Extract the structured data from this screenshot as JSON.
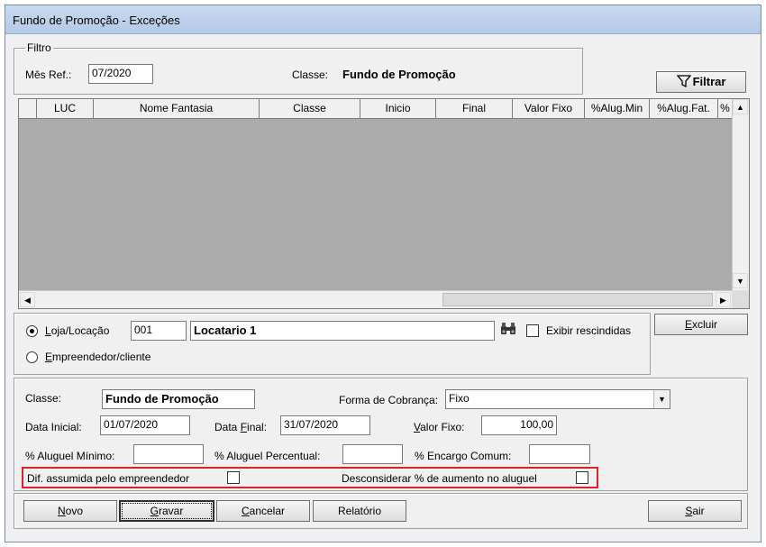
{
  "window": {
    "title": "Fundo de Promoção - Exceções"
  },
  "filtro": {
    "legend": "Filtro",
    "mes_ref_label": "Mês Ref.:",
    "mes_ref_value": "07/2020",
    "classe_label": "Classe:",
    "classe_value": "Fundo de Promoção",
    "filtrar_button": "Filtrar"
  },
  "grid": {
    "columns": [
      "",
      "LUC",
      "Nome Fantasia",
      "Classe",
      "Inicio",
      "Final",
      "Valor Fixo",
      "%Alug.Min",
      "%Alug.Fat.",
      "%"
    ],
    "rows": []
  },
  "selection": {
    "loja_label_u": "L",
    "loja_label_rest": "oja/Locação",
    "loja_code": "001",
    "loja_name": "Locatario 1",
    "exibir_rescindidas": "Exibir rescindidas",
    "empreendedor_label_u": "E",
    "empreendedor_label_rest": "mpreendedor/cliente",
    "loja_selected": true,
    "exibir_checked": false,
    "excluir_u": "E",
    "excluir_rest": "xcluir"
  },
  "details": {
    "classe_label": "Classe:",
    "classe_value": "Fundo de Promoção",
    "forma_cobranca_label": "Forma de Cobrança:",
    "forma_cobranca_value": "Fixo",
    "data_inicial_label": "Data Inicial:",
    "data_inicial_value": "01/07/2020",
    "data_final_label_pre": "Data ",
    "data_final_label_u": "F",
    "data_final_label_rest": "inal:",
    "data_final_value": "31/07/2020",
    "valor_fixo_label_u": "V",
    "valor_fixo_label_rest": "alor Fixo:",
    "valor_fixo_value": "100,00",
    "aluguel_minimo_label": "% Aluguel Mínimo:",
    "aluguel_minimo_value": "",
    "aluguel_percentual_label": "% Aluguel Percentual:",
    "aluguel_percentual_value": "",
    "encargo_comum_label": "% Encargo Comum:",
    "encargo_comum_value": "",
    "dif_assumida_label": "Dif. assumida pelo empreendedor",
    "dif_assumida_checked": false,
    "desconsiderar_label": "Desconsiderar % de aumento no aluguel",
    "desconsiderar_checked": false,
    "highlight_color": "#d9232a"
  },
  "footer": {
    "novo_u": "N",
    "novo_rest": "ovo",
    "gravar_u": "G",
    "gravar_rest": "ravar",
    "cancelar_u": "C",
    "cancelar_rest": "ancelar",
    "relatorio": "Relatório",
    "sair_u": "S",
    "sair_rest": "air"
  }
}
